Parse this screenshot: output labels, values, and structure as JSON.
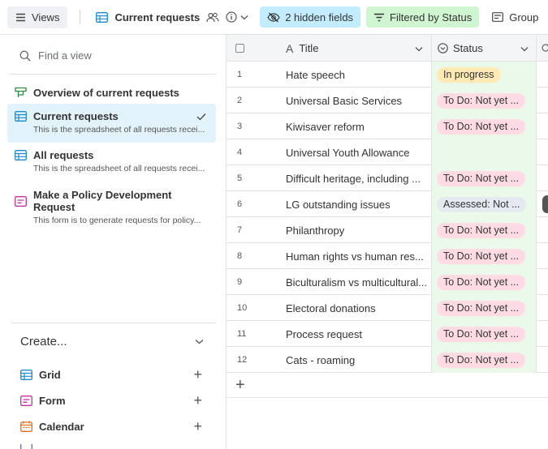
{
  "toolbar": {
    "views_label": "Views",
    "view_name": "Current requests",
    "hidden_fields_label": "2 hidden fields",
    "filter_label": "Filtered by Status",
    "group_label": "Group"
  },
  "sidebar": {
    "search_placeholder": "Find a view",
    "views": [
      {
        "title": "Overview of current requests",
        "desc": "",
        "icon": "interface-icon",
        "icon_color": "#2d8a3e"
      },
      {
        "title": "Current requests",
        "desc": "This is the spreadsheet of all requests recei...",
        "icon": "grid-icon",
        "icon_color": "#1f8acb",
        "active": true
      },
      {
        "title": "All requests",
        "desc": "This is the spreadsheet of all requests recei...",
        "icon": "grid-icon",
        "icon_color": "#1f8acb"
      },
      {
        "title": "Make a Policy Development Request",
        "desc": "This form is to generate requests for policy...",
        "icon": "form-icon",
        "icon_color": "#c4349a"
      }
    ],
    "create": {
      "label": "Create...",
      "items": [
        {
          "label": "Grid",
          "icon": "grid-icon",
          "icon_color": "#1f8acb"
        },
        {
          "label": "Form",
          "icon": "form-icon",
          "icon_color": "#c4349a"
        },
        {
          "label": "Calendar",
          "icon": "calendar-icon",
          "icon_color": "#e0701e"
        }
      ]
    }
  },
  "grid": {
    "columns": {
      "title": "Title",
      "status": "Status"
    },
    "rows": [
      {
        "num": "1",
        "title": "Hate speech",
        "status": "In progress",
        "status_color": "#ffeab6"
      },
      {
        "num": "2",
        "title": "Universal Basic Services",
        "status": "To Do: Not yet ...",
        "status_color": "#ffdce5"
      },
      {
        "num": "3",
        "title": "Kiwisaver reform",
        "status": "To Do: Not yet ...",
        "status_color": "#ffdce5"
      },
      {
        "num": "4",
        "title": "Universal Youth Allowance",
        "status": "",
        "status_color": ""
      },
      {
        "num": "5",
        "title": "Difficult heritage, including ...",
        "status": "To Do: Not yet ...",
        "status_color": "#ffdce5"
      },
      {
        "num": "6",
        "title": "LG outstanding issues",
        "status": "Assessed: Not ...",
        "status_color": "#e5e9f0"
      },
      {
        "num": "7",
        "title": "Philanthropy",
        "status": "To Do: Not yet ...",
        "status_color": "#ffdce5"
      },
      {
        "num": "8",
        "title": "Human rights vs human res...",
        "status": "To Do: Not yet ...",
        "status_color": "#ffdce5"
      },
      {
        "num": "9",
        "title": "Biculturalism vs multicultural...",
        "status": "To Do: Not yet ...",
        "status_color": "#ffdce5"
      },
      {
        "num": "10",
        "title": "Electoral donations",
        "status": "To Do: Not yet ...",
        "status_color": "#ffdce5"
      },
      {
        "num": "11",
        "title": "Process request",
        "status": "To Do: Not yet ...",
        "status_color": "#ffdce5"
      },
      {
        "num": "12",
        "title": "Cats - roaming",
        "status": "To Do: Not yet ...",
        "status_color": "#ffdce5"
      }
    ]
  }
}
